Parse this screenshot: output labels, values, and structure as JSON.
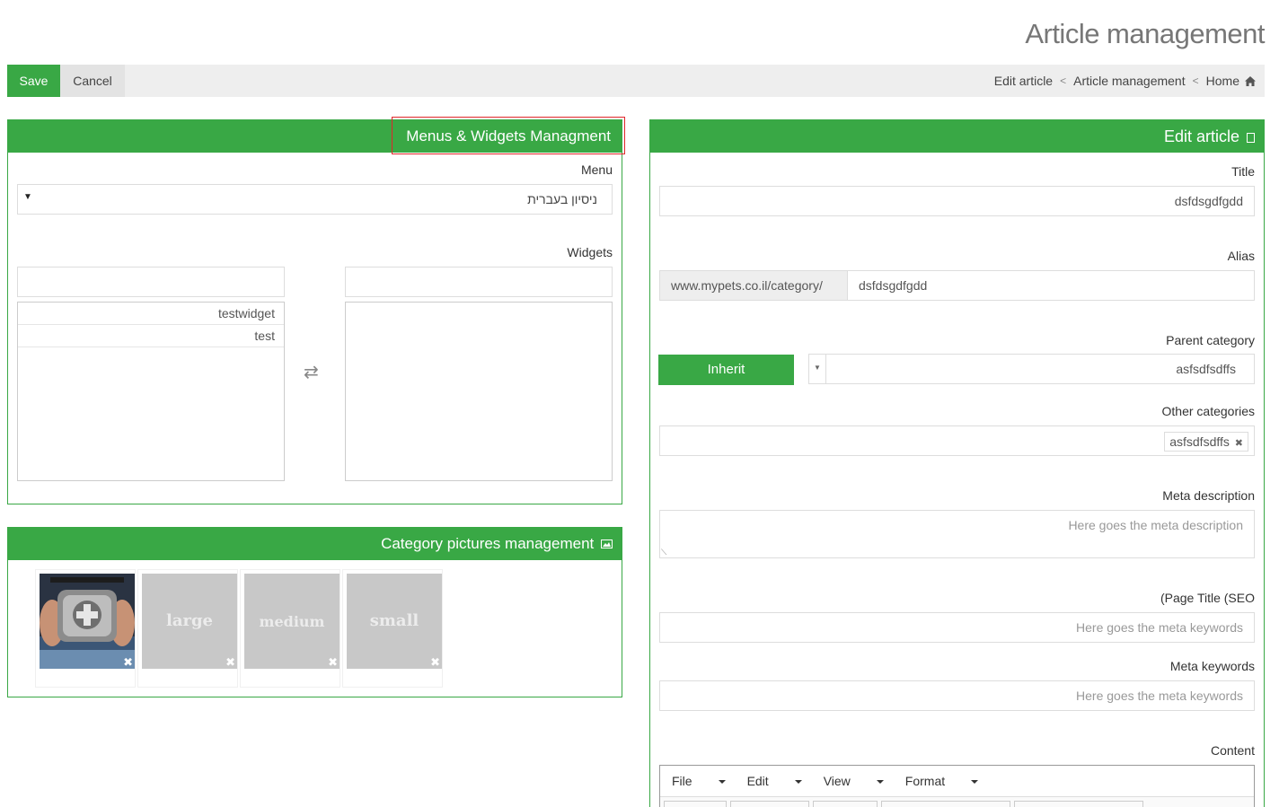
{
  "header": {
    "title": "Article management"
  },
  "toolbar": {
    "save_label": "Save",
    "cancel_label": "Cancel",
    "breadcrumb": [
      "Edit article",
      "Article management",
      "Home"
    ]
  },
  "menus_panel": {
    "title": "Menus & Widgets Managment",
    "menu_label": "Menu",
    "menu_value": "ניסיון בעברית",
    "widgets_label": "Widgets",
    "available_widgets": [
      "testwidget",
      "test"
    ],
    "swap_icon": "⇄"
  },
  "pictures_panel": {
    "title": "Category pictures management",
    "thumbnails": [
      "large",
      "medium",
      "small"
    ]
  },
  "edit_panel": {
    "title": "Edit article",
    "title_label": "Title",
    "title_value": "dsfdsgdfgdd",
    "alias_label": "Alias",
    "alias_prefix": "www.mypets.co.il/category/",
    "alias_value": "dsfdsgdfgdd",
    "parent_label": "Parent category",
    "inherit_label": "Inherit",
    "parent_value": "asfsdfsdffs",
    "other_label": "Other categories",
    "other_tag": "asfsdfsdffs",
    "meta_desc_label": "Meta description",
    "meta_desc_placeholder": "Here goes the meta description",
    "seo_label": "(Page Title (SEO",
    "seo_placeholder": "Here goes the meta keywords",
    "meta_kw_label": "Meta keywords",
    "meta_kw_placeholder": "Here goes the meta keywords",
    "content_label": "Content",
    "editor_menu": [
      "File",
      "Edit",
      "View",
      "Format"
    ]
  },
  "colors": {
    "accent": "#39a845",
    "highlight": "#e0262a"
  }
}
